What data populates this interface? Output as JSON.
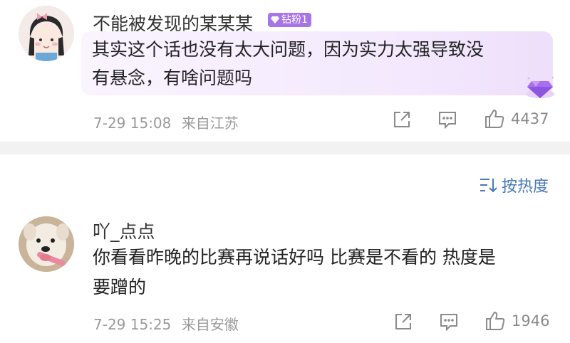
{
  "comments": [
    {
      "username": "不能被发现的某某某",
      "badge": "钻粉1",
      "text_line1": "其实这个话也没有太大问题，因为实力太强导致没",
      "text_line2": "有悬念，有啥问题吗",
      "time": "7-29 15:08",
      "location": "来自江苏",
      "likes": "4437",
      "icons": [
        "share-icon",
        "comment-icon",
        "like-icon"
      ]
    },
    {
      "username": "吖_点点",
      "text_line1": "你看看昨晚的比赛再说话好吗 比赛是不看的 热度是",
      "text_line2": "要蹭的",
      "time": "7-29 15:25",
      "location": "来自安徽",
      "likes": "1946",
      "icons": [
        "share-icon",
        "comment-icon",
        "like-icon"
      ]
    }
  ],
  "sort": {
    "label": "按热度",
    "icon": "sort-icon"
  },
  "colors": {
    "badge": "#a875e8",
    "link": "#4a78b5",
    "meta": "#9a9a9a",
    "divider": "#f2f2f2"
  }
}
